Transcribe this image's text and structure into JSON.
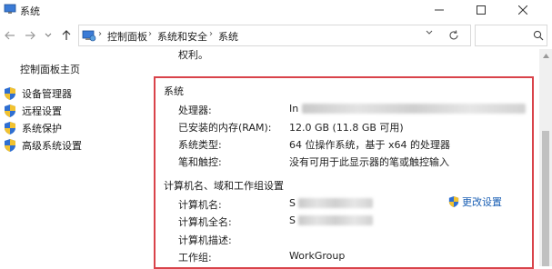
{
  "window": {
    "title": "系统"
  },
  "address": {
    "crumbs": [
      "控制面板",
      "系统和安全",
      "系统"
    ]
  },
  "sidebar": {
    "home": "控制面板主页",
    "items": [
      {
        "label": "设备管理器",
        "icon": "uac-shield-icon"
      },
      {
        "label": "远程设置",
        "icon": "uac-shield-icon"
      },
      {
        "label": "系统保护",
        "icon": "uac-shield-icon"
      },
      {
        "label": "高级系统设置",
        "icon": "uac-shield-icon"
      }
    ]
  },
  "main": {
    "rights_text": "权利。",
    "system_section": {
      "title": "系统",
      "rows": [
        {
          "label": "处理器:",
          "value": "In",
          "redacted": true
        },
        {
          "label": "已安装的内存(RAM):",
          "value": "12.0 GB (11.8 GB 可用)"
        },
        {
          "label": "系统类型:",
          "value": "64 位操作系统，基于 x64 的处理器"
        },
        {
          "label": "笔和触控:",
          "value": "没有可用于此显示器的笔或触控输入"
        }
      ]
    },
    "computer_section": {
      "title": "计算机名、域和工作组设置",
      "change_settings": "更改设置",
      "rows": [
        {
          "label": "计算机名:",
          "value": "S",
          "redacted": true
        },
        {
          "label": "计算机全名:",
          "value": "S",
          "redacted": true
        },
        {
          "label": "计算机描述:",
          "value": ""
        },
        {
          "label": "工作组:",
          "value": "WorkGroup"
        }
      ]
    }
  },
  "colors": {
    "highlight_border": "#d9434a",
    "link": "#1a5fb4",
    "shield_blue": "#2f6fd1",
    "shield_yellow": "#f2c230"
  }
}
